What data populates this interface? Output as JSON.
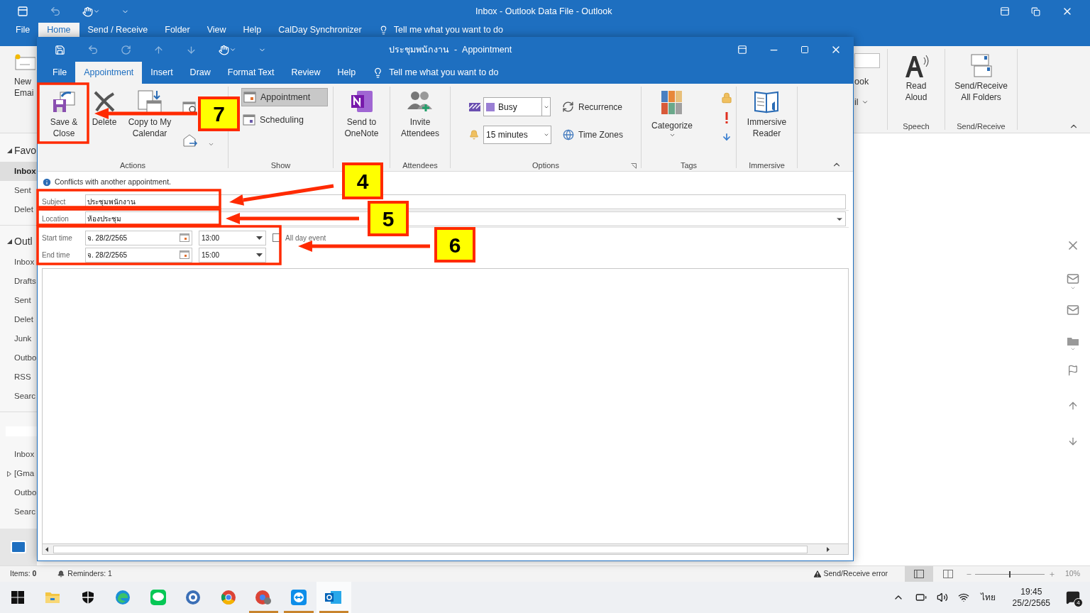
{
  "main_window": {
    "title": "Inbox - Outlook Data File  -  Outlook",
    "tabs": [
      {
        "label": "File",
        "selected": false
      },
      {
        "label": "Home",
        "selected": true
      },
      {
        "label": "Send / Receive",
        "selected": false
      },
      {
        "label": "Folder",
        "selected": false
      },
      {
        "label": "View",
        "selected": false
      },
      {
        "label": "Help",
        "selected": false
      },
      {
        "label": "CalDay Synchronizer",
        "selected": false
      }
    ],
    "tell_me": "Tell me what you want to do",
    "ribbon": {
      "new_email": [
        "New",
        "Emai"
      ],
      "fragments": [
        "ook",
        "il"
      ],
      "groups": [
        {
          "name": "Speech",
          "kind": "read_aloud",
          "label": "Read Aloud"
        },
        {
          "name": "Send/Receive",
          "kind": "send_receive",
          "label": "Send/Receive All Folders"
        }
      ]
    },
    "sidebar": {
      "sections": [
        {
          "label": "Favo",
          "kind": "account",
          "items": [
            {
              "label": "Inbox",
              "selected": true
            },
            {
              "label": "Sent",
              "selected": false
            },
            {
              "label": "Delet",
              "selected": false
            }
          ]
        },
        {
          "label": "Outl",
          "kind": "account",
          "items": [
            {
              "label": "Inbox",
              "selected": false
            },
            {
              "label": "Drafts",
              "selected": false
            },
            {
              "label": "Sent",
              "selected": false
            },
            {
              "label": "Delet",
              "selected": false
            },
            {
              "label": "Junk",
              "selected": false
            },
            {
              "label": "Outbo",
              "selected": false
            },
            {
              "label": "RSS",
              "selected": false
            },
            {
              "label": "Searc",
              "selected": false
            }
          ]
        },
        {
          "kind": "blank",
          "items": [
            {
              "label": "Inbox",
              "selected": false
            },
            {
              "label": "[Gma",
              "selected": false,
              "expanded": false
            },
            {
              "label": "Outbo",
              "selected": false
            },
            {
              "label": "Searc",
              "selected": false
            }
          ]
        }
      ]
    },
    "status_bar": {
      "items_label": "Items:",
      "items_count": "0",
      "reminders": "Reminders: 1",
      "error": "Send/Receive error",
      "zoom": {
        "level": 0.5,
        "label": "10%"
      }
    }
  },
  "appointment_window": {
    "title": "ประชุมพนักงาน  -  Appointment",
    "tabs": [
      {
        "label": "File",
        "selected": false
      },
      {
        "label": "Appointment",
        "selected": true
      },
      {
        "label": "Insert",
        "selected": false
      },
      {
        "label": "Draw",
        "selected": false
      },
      {
        "label": "Format Text",
        "selected": false
      },
      {
        "label": "Review",
        "selected": false
      },
      {
        "label": "Help",
        "selected": false
      }
    ],
    "tell_me": "Tell me what you want to do",
    "ribbon": {
      "actions": {
        "name": "Actions",
        "save_close": "Save & Close",
        "delete": "Delete",
        "copy": "Copy to My Calendar"
      },
      "show": {
        "name": "Show",
        "views": [
          {
            "label": "Appointment",
            "selected": true
          },
          {
            "label": "Scheduling",
            "selected": false
          }
        ]
      },
      "onenote": {
        "label": "Send to OneNote"
      },
      "attendees": {
        "name": "Attendees",
        "label": "Invite Attendees"
      },
      "options": {
        "name": "Options",
        "show_as": {
          "value": "Busy",
          "color": "#9a7fd4"
        },
        "reminder": "15 minutes",
        "recurrence": "Recurrence",
        "time_zones": "Time Zones"
      },
      "tags": {
        "name": "Tags",
        "categorize": "Categorize"
      },
      "immersive": {
        "name": "Immersive",
        "label": "Immersive Reader"
      }
    },
    "form": {
      "info": "Conflicts with another appointment.",
      "subject": {
        "label": "Subject",
        "value": "ประชุมพนักงาน"
      },
      "location": {
        "label": "Location",
        "value": "ห้องประชุม"
      },
      "start": {
        "label": "Start time",
        "date": "จ. 28/2/2565",
        "time": "13:00"
      },
      "end": {
        "label": "End time",
        "date": "จ. 28/2/2565",
        "time": "15:00"
      },
      "all_day": {
        "label": "All day event",
        "checked": false
      }
    }
  },
  "annotations": [
    {
      "label": "7"
    },
    {
      "label": "4"
    },
    {
      "label": "5"
    },
    {
      "label": "6"
    }
  ],
  "taskbar": {
    "apps": [
      {
        "kind": "start",
        "running": false,
        "selected": false
      },
      {
        "kind": "explorer",
        "running": false,
        "selected": false
      },
      {
        "kind": "security",
        "running": false,
        "selected": false
      },
      {
        "kind": "edge",
        "running": false,
        "selected": false
      },
      {
        "kind": "line",
        "running": false,
        "selected": false
      },
      {
        "kind": "app",
        "running": false,
        "selected": false
      },
      {
        "kind": "chrome",
        "running": false,
        "selected": false
      },
      {
        "kind": "chrome_profile",
        "running": true,
        "selected": false
      },
      {
        "kind": "teamviewer",
        "running": true,
        "selected": false
      },
      {
        "kind": "outlook",
        "running": true,
        "selected": true
      }
    ],
    "language": "ไทย",
    "time": "19:45",
    "date": "25/2/2565",
    "notifications": "4"
  }
}
